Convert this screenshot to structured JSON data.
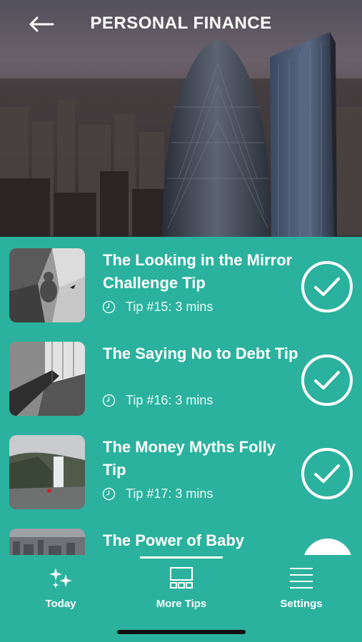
{
  "header": {
    "title": "PERSONAL FINANCE",
    "back_icon": "arrow-left-icon"
  },
  "tips": [
    {
      "title": "The Looking in the Mirror Challenge Tip",
      "meta": "Tip #15: 3 mins",
      "completed": true
    },
    {
      "title": "The Saying No to Debt Tip",
      "meta": "Tip #16: 3 mins",
      "completed": true
    },
    {
      "title": "The Money Myths Folly Tip",
      "meta": "Tip #17: 3 mins",
      "completed": true
    },
    {
      "title": "The Power of Baby",
      "meta": "",
      "completed": true
    }
  ],
  "tabbar": {
    "today": {
      "label": "Today",
      "icon": "sparkles-icon"
    },
    "more_tips": {
      "label": "More Tips",
      "icon": "grid-layout-icon"
    },
    "settings": {
      "label": "Settings",
      "icon": "menu-icon"
    },
    "active": "more_tips"
  },
  "colors": {
    "accent": "#2bb29e",
    "text": "#ffffff"
  }
}
